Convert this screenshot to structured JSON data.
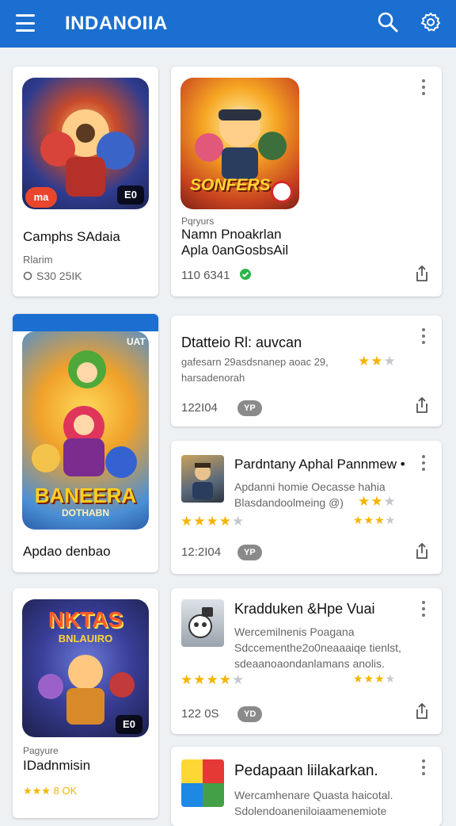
{
  "appbar": {
    "title": "INDANOIIA",
    "menu_icon": "hamburger-menu-icon",
    "search_icon": "search-icon",
    "settings_icon": "gear-icon"
  },
  "cards": {
    "c1": {
      "title": "Camphs SAdaia",
      "subtitle": "Rlarim",
      "meta": "S30 25IK",
      "badge": "E0",
      "logo": "ma"
    },
    "c2": {
      "tag": "Pqryurs",
      "title_line1": "Namn Pnoakrlan",
      "title_line2": "Apla 0anGosbsAil",
      "meta": "110 6341",
      "art_text": "SONFERS"
    },
    "c3": {
      "caption": "Apdao denbao",
      "art_text": "BANEERA",
      "art_sub": "DOTHABN",
      "corner": "UAT"
    },
    "c4": {
      "title": "Dtatteio Rl: auvcan",
      "desc1": "gafesarn 29asdsnanep aoac 29,",
      "desc2": "harsadenorah",
      "meta": "122I04",
      "pill": "YP",
      "rating": 2.5
    },
    "c5": {
      "title": "Pardntany Aphal Pannmew •",
      "desc1": "Apdanni homie Oecasse hahia",
      "desc2": "Blasdandoolmeing @)",
      "meta": "12:2I04",
      "pill": "YP",
      "rating_a": 3.5,
      "rating_b": 2.5,
      "rating_c": 3.5
    },
    "c6": {
      "tag": "Pagyure",
      "title": "IDadnmisin",
      "meta": "★★★ 8 OK",
      "art_text": "NKTAS",
      "art_sub": "BNLAUIRO",
      "badge": "E0"
    },
    "c7": {
      "title": "Kradduken &Hpe Vuai",
      "desc1": "Wercemilnenis Poagana",
      "desc2": "Sdccementhe2o0neaaaiqe tienlst,",
      "desc3": "sdeaanoaondanlamans anolis.",
      "meta": "122 0S",
      "pill": "YD",
      "rating_a": 3.5,
      "rating_b": 2.5
    },
    "c8": {
      "title": "Pedapaan liilakarkan.",
      "desc1": "Wercamhenare Quasta haicotal.",
      "desc2": "Sdolendoaneniloiaamenemiote"
    }
  },
  "colors": {
    "appbar": "#1b6fd0",
    "star": "#f5b400",
    "background": "#eef1f4"
  }
}
